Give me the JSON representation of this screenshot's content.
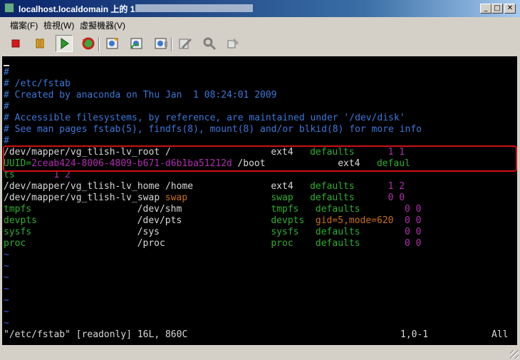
{
  "window": {
    "title": "localhost.localdomain 上的 1",
    "minimize_glyph": "_",
    "maximize_glyph": "□",
    "close_glyph": "✕"
  },
  "menu": [
    "檔案(F)",
    "檢視(W)",
    "虛擬機器(V)"
  ],
  "toolbar": {
    "icons": [
      "stop-icon",
      "pause-icon",
      "play-icon",
      "reset-icon",
      "snapshot-take-icon",
      "snapshot-revert-icon",
      "snapshot-manager-icon",
      "settings-icon",
      "tools-icon",
      "config-icon"
    ],
    "colors": {
      "stop": "#d81818",
      "pause": "#e8a010",
      "play": "#2a9a2a",
      "reset": "#c82020"
    }
  },
  "terminal": {
    "colors": {
      "comment": "#3a78d8",
      "text": "#d8d8d8",
      "keyword": "#2eae2e",
      "number": "#b12cb1",
      "special": "#c8701a",
      "tilde": "#3a58d8"
    },
    "lines": [
      {
        "segs": [
          {
            "text": "#",
            "c": "comment",
            "col": 0
          }
        ]
      },
      {
        "segs": [
          {
            "text": "# /etc/fstab",
            "c": "comment",
            "col": 0
          }
        ]
      },
      {
        "segs": [
          {
            "text": "# Created by anaconda on Thu Jan  1 08:24:01 2009",
            "c": "comment",
            "col": 0
          }
        ]
      },
      {
        "segs": [
          {
            "text": "#",
            "c": "comment",
            "col": 0
          }
        ]
      },
      {
        "segs": [
          {
            "text": "# Accessible filesystems, by reference, are maintained under '/dev/disk'",
            "c": "comment",
            "col": 0
          }
        ]
      },
      {
        "segs": [
          {
            "text": "# See man pages fstab(5), findfs(8), mount(8) and/or blkid(8) for more info",
            "c": "comment",
            "col": 0
          }
        ]
      },
      {
        "segs": [
          {
            "text": "#",
            "c": "comment",
            "col": 0
          }
        ]
      },
      {
        "segs": [
          {
            "text": "/dev/mapper/vg_tlish-lv_root /",
            "c": "white",
            "col": 0
          },
          {
            "text": "ext4",
            "c": "white",
            "col": 48
          },
          {
            "text": "defaults",
            "c": "green",
            "col": 55
          },
          {
            "text": "1 1",
            "c": "magenta",
            "col": 69
          }
        ]
      },
      {
        "segs": [
          {
            "text": "UUID=",
            "c": "green",
            "col": 0
          },
          {
            "text": "2ceab424-8006-4809-b671-d6b1ba51212d",
            "c": "magenta",
            "col": 5
          },
          {
            "text": " /boot",
            "c": "white",
            "col": 41
          },
          {
            "text": "ext4",
            "c": "white",
            "col": 60
          },
          {
            "text": "defaul",
            "c": "green",
            "col": 67
          }
        ]
      },
      {
        "segs": [
          {
            "text": "ts",
            "c": "green",
            "col": 0
          },
          {
            "text": "1 2",
            "c": "magenta",
            "col": 9
          }
        ]
      },
      {
        "segs": [
          {
            "text": "/dev/mapper/vg_tlish-lv_home /home",
            "c": "white",
            "col": 0
          },
          {
            "text": "ext4",
            "c": "white",
            "col": 48
          },
          {
            "text": "defaults",
            "c": "green",
            "col": 55
          },
          {
            "text": "1 2",
            "c": "magenta",
            "col": 69
          }
        ]
      },
      {
        "segs": [
          {
            "text": "/dev/mapper/vg_tlish-lv_swap ",
            "c": "white",
            "col": 0
          },
          {
            "text": "swap",
            "c": "orange",
            "col": 29
          },
          {
            "text": "swap",
            "c": "green",
            "col": 48
          },
          {
            "text": "defaults",
            "c": "green",
            "col": 55
          },
          {
            "text": "0 0",
            "c": "magenta",
            "col": 69
          }
        ]
      },
      {
        "segs": [
          {
            "text": "tmpfs",
            "c": "green",
            "col": 0
          },
          {
            "text": "/dev/shm",
            "c": "white",
            "col": 24
          },
          {
            "text": "tmpfs",
            "c": "green",
            "col": 48
          },
          {
            "text": "defaults",
            "c": "green",
            "col": 56
          },
          {
            "text": "0 0",
            "c": "magenta",
            "col": 72
          }
        ]
      },
      {
        "segs": [
          {
            "text": "devpts",
            "c": "green",
            "col": 0
          },
          {
            "text": "/dev/pts",
            "c": "white",
            "col": 24
          },
          {
            "text": "devpts",
            "c": "green",
            "col": 48
          },
          {
            "text": "gid=5,mode=620",
            "c": "orange",
            "col": 56
          },
          {
            "text": "0 0",
            "c": "magenta",
            "col": 72
          }
        ]
      },
      {
        "segs": [
          {
            "text": "sysfs",
            "c": "green",
            "col": 0
          },
          {
            "text": "/sys",
            "c": "white",
            "col": 24
          },
          {
            "text": "sysfs",
            "c": "green",
            "col": 48
          },
          {
            "text": "defaults",
            "c": "green",
            "col": 56
          },
          {
            "text": "0 0",
            "c": "magenta",
            "col": 72
          }
        ]
      },
      {
        "segs": [
          {
            "text": "proc",
            "c": "green",
            "col": 0
          },
          {
            "text": "/proc",
            "c": "white",
            "col": 24
          },
          {
            "text": "proc",
            "c": "green",
            "col": 48
          },
          {
            "text": "defaults",
            "c": "green",
            "col": 56
          },
          {
            "text": "0 0",
            "c": "magenta",
            "col": 72
          }
        ]
      },
      {
        "segs": [
          {
            "text": "~",
            "c": "blue",
            "col": 0
          }
        ]
      },
      {
        "segs": [
          {
            "text": "~",
            "c": "blue",
            "col": 0
          }
        ]
      },
      {
        "segs": [
          {
            "text": "~",
            "c": "blue",
            "col": 0
          }
        ]
      },
      {
        "segs": [
          {
            "text": "~",
            "c": "blue",
            "col": 0
          }
        ]
      },
      {
        "segs": [
          {
            "text": "~",
            "c": "blue",
            "col": 0
          }
        ]
      },
      {
        "segs": [
          {
            "text": "~",
            "c": "blue",
            "col": 0
          }
        ]
      },
      {
        "segs": [
          {
            "text": "~",
            "c": "blue",
            "col": 0
          }
        ]
      }
    ],
    "status": {
      "file": "\"/etc/fstab\" [readonly] 16L, 860C",
      "position": "1,0-1",
      "scroll": "All"
    }
  }
}
